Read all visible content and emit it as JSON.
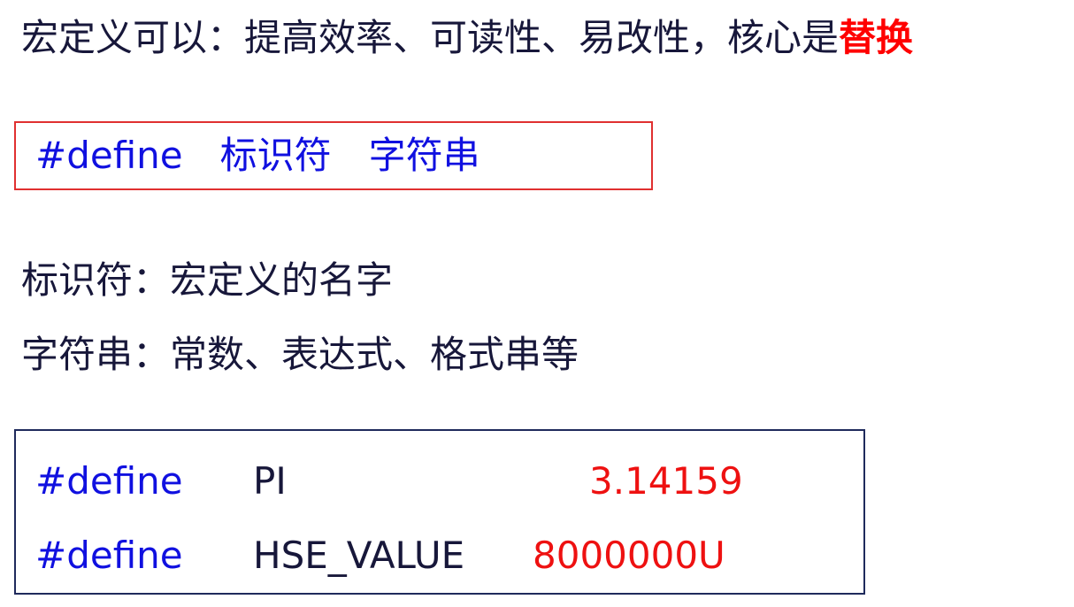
{
  "headline": {
    "text": "宏定义可以：提高效率、可读性、易改性，核心是",
    "emphasis": "替换"
  },
  "syntax": {
    "keyword": "#define",
    "identifier": "标识符",
    "string": "字符串"
  },
  "descriptions": {
    "identifier": "标识符：宏定义的名字",
    "string": "字符串：常数、表达式、格式串等"
  },
  "examples": [
    {
      "keyword": "#define",
      "name": "PI",
      "value": "3.14159"
    },
    {
      "keyword": "#define",
      "name": "HSE_VALUE",
      "value": "8000000U"
    }
  ],
  "colors": {
    "keyword": "#1010e0",
    "value": "#ee1111",
    "emphasis": "#ff0000",
    "syntax_border": "#e03030",
    "example_border": "#1f2a5c"
  }
}
